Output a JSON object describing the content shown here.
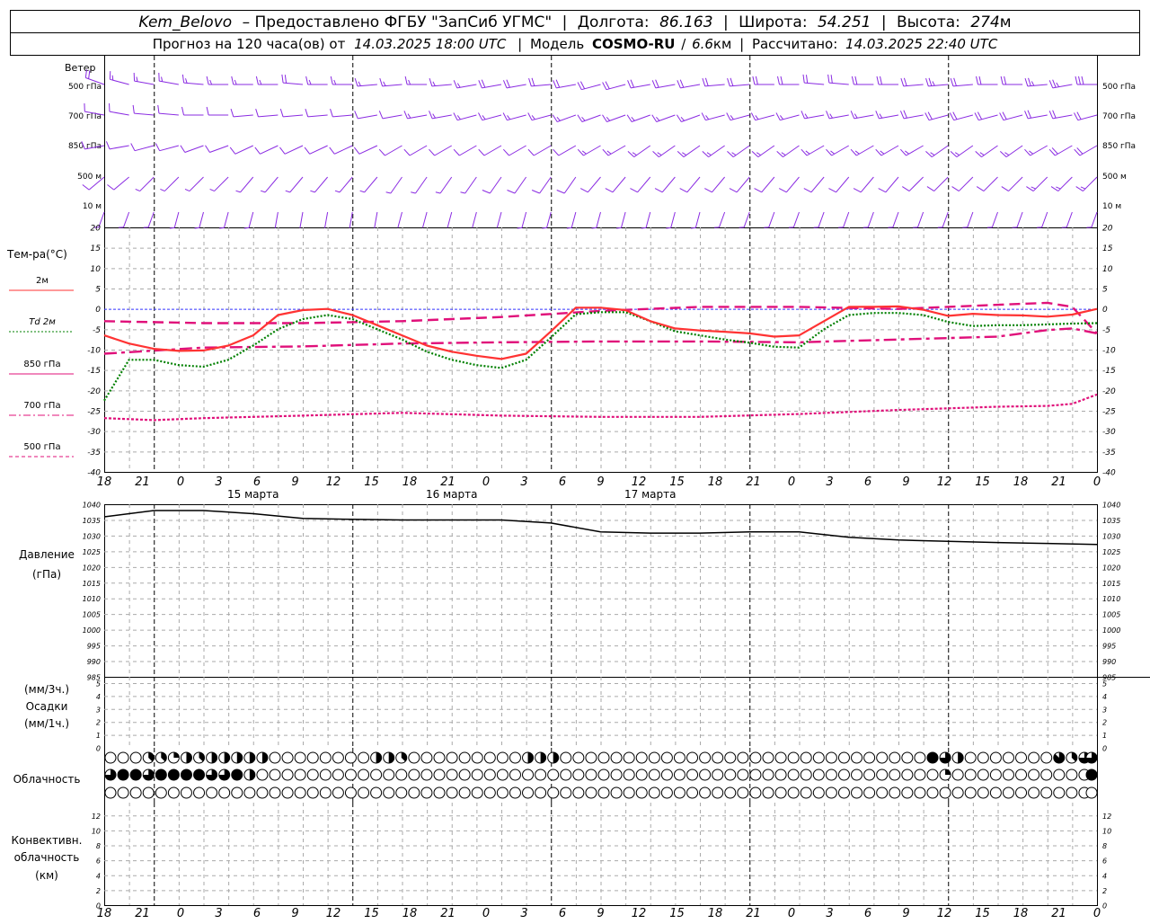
{
  "header": {
    "station": "Kem_Belovo",
    "provided": "– Предоставлено ФГБУ \"ЗапСиб УГМС\"",
    "lon_label": "Долгота:",
    "lon_value": "86.163",
    "lat_label": "Широта:",
    "lat_value": "54.251",
    "alt_label": "Высота:",
    "alt_value": "274",
    "alt_unit": "м",
    "forecast_prefix": "Прогноз на 120 часа(ов) от",
    "forecast_from": "14.03.2025 18:00 UTC",
    "model_label": "Модель",
    "model_name": "COSMO-RU",
    "model_res": "6.6",
    "model_res_unit": "км",
    "calc_label": "Рассчитано:",
    "calc_time": "14.03.2025 22:40 UTC"
  },
  "wind_panel": {
    "title": "Ветер",
    "levels": [
      "500 гПа",
      "700 гПа",
      "850 гПа",
      "500 м",
      "10 м"
    ]
  },
  "temp_panel": {
    "title": "Тем-ра(°C)",
    "legend": [
      {
        "label": "2м",
        "color": "#ff3333",
        "dash": "solid"
      },
      {
        "label": "Td  2м",
        "color": "#008000",
        "dash": "dotted"
      },
      {
        "label": "850 гПа",
        "color": "#e0107a",
        "dash": "solid"
      },
      {
        "label": "700 гПа",
        "color": "#e0107a",
        "dash": "dashdot"
      },
      {
        "label": "500 гПа",
        "color": "#e0107a",
        "dash": "dashed"
      }
    ]
  },
  "pressure_panel": {
    "title": "Давление",
    "unit": "(гПа)"
  },
  "precip_panel": {
    "unit_top": "(мм/3ч.)",
    "title": "Осадки",
    "unit_bottom": "(мм/1ч.)"
  },
  "cloud_panel": {
    "title": "Облачность"
  },
  "conv_panel": {
    "title_1": "Конвективн.",
    "title_2": "облачность",
    "unit": "(км)"
  },
  "time_axis": {
    "hour_labels": [
      "18",
      "21",
      "0",
      "3",
      "6",
      "9",
      "12",
      "15",
      "18",
      "21",
      "0",
      "3",
      "6",
      "9",
      "12",
      "15",
      "18",
      "21",
      "0",
      "3",
      "6",
      "9",
      "12",
      "15",
      "18",
      "21",
      "0"
    ],
    "date_labels": [
      "15 марта",
      "16 марта",
      "17 марта"
    ]
  },
  "colors": {
    "wind": "#8a2be2",
    "t2m": "#ff3333",
    "td": "#008000",
    "upper": "#e0107a",
    "zero_line": "#3333ff"
  },
  "chart_data": [
    {
      "type": "line",
      "title": "Тем-ра(°C)",
      "x_unit": "hours from 14.03.2025 18:00 UTC",
      "ylim": [
        -40,
        20
      ],
      "yticks": [
        20,
        15,
        10,
        5,
        0,
        -5,
        -10,
        -15,
        -20,
        -25,
        -30,
        -35,
        -40
      ],
      "grid": true,
      "series": [
        {
          "name": "2м",
          "x": [
            0,
            3,
            6,
            9,
            12,
            15,
            18,
            21,
            24,
            27,
            30,
            33,
            36,
            39,
            42,
            45,
            48,
            51,
            54,
            57,
            60,
            63,
            66,
            69,
            72,
            75,
            78,
            81,
            84,
            87,
            90,
            93,
            96,
            99,
            102,
            105,
            108,
            111,
            114,
            117,
            120
          ],
          "values": [
            -6.5,
            -8.5,
            -9.8,
            -10.3,
            -10.2,
            -9.0,
            -6.5,
            -1.5,
            -0.3,
            0.0,
            -1.5,
            -4.0,
            -6.5,
            -9.0,
            -10.5,
            -11.5,
            -12.3,
            -11.0,
            -5.5,
            0.3,
            0.3,
            -0.3,
            -3.0,
            -4.8,
            -5.3,
            -5.6,
            -6.0,
            -6.8,
            -6.5,
            -3.0,
            0.5,
            0.5,
            0.6,
            -0.2,
            -1.7,
            -1.2,
            -1.5,
            -1.6,
            -1.9,
            -1.4,
            0.0
          ]
        },
        {
          "name": "Td  2м",
          "x": [
            0,
            3,
            6,
            9,
            12,
            15,
            18,
            21,
            24,
            27,
            30,
            33,
            36,
            39,
            42,
            45,
            48,
            51,
            54,
            57,
            60,
            63,
            66,
            69,
            72,
            75,
            78,
            81,
            84,
            87,
            90,
            93,
            96,
            99,
            102,
            105,
            108,
            111,
            114,
            117,
            120
          ],
          "values": [
            -22.5,
            -12.5,
            -12.5,
            -13.8,
            -14.2,
            -12.5,
            -9.0,
            -5.0,
            -2.5,
            -1.5,
            -2.5,
            -5.0,
            -7.5,
            -10.5,
            -12.5,
            -13.8,
            -14.5,
            -12.5,
            -7.0,
            -1.3,
            -0.8,
            -0.8,
            -3.0,
            -5.5,
            -6.5,
            -7.5,
            -8.3,
            -9.3,
            -9.5,
            -5.0,
            -1.5,
            -1.0,
            -1.0,
            -1.5,
            -3.2,
            -4.2,
            -4.0,
            -4.0,
            -3.8,
            -3.6,
            -3.5
          ]
        },
        {
          "name": "850 гПа",
          "x": [
            0,
            12,
            24,
            36,
            48,
            60,
            72,
            84,
            96,
            108,
            114,
            117,
            120
          ],
          "values": [
            -3.0,
            -3.5,
            -3.5,
            -3.0,
            -2.0,
            -0.5,
            0.5,
            0.5,
            0.0,
            1.0,
            1.5,
            0.5,
            -6.0
          ]
        },
        {
          "name": "700 гПа",
          "x": [
            0,
            12,
            24,
            36,
            48,
            60,
            72,
            84,
            96,
            108,
            114,
            117,
            120
          ],
          "values": [
            -11.0,
            -9.5,
            -9.2,
            -8.5,
            -8.2,
            -8.0,
            -8.0,
            -8.2,
            -7.5,
            -6.8,
            -5.2,
            -4.8,
            -6.0
          ]
        },
        {
          "name": "500 гПа",
          "x": [
            0,
            6,
            12,
            18,
            24,
            36,
            48,
            60,
            72,
            84,
            96,
            108,
            114,
            117,
            120
          ],
          "values": [
            -26.8,
            -27.3,
            -26.8,
            -26.5,
            -26.2,
            -25.5,
            -26.2,
            -26.5,
            -26.5,
            -25.8,
            -24.8,
            -24.0,
            -23.8,
            -23.3,
            -21.0
          ]
        }
      ]
    },
    {
      "type": "line",
      "title": "Давление",
      "ylabel": "(гПа)",
      "ylim": [
        985,
        1040
      ],
      "yticks": [
        1040,
        1035,
        1030,
        1025,
        1020,
        1015,
        1010,
        1005,
        1000,
        995,
        990,
        985
      ],
      "grid": true,
      "series": [
        {
          "x": [
            0,
            6,
            12,
            18,
            24,
            30,
            36,
            42,
            48,
            54,
            60,
            66,
            72,
            78,
            84,
            90,
            96,
            102,
            108,
            114,
            120
          ],
          "values": [
            1036.0,
            1038.0,
            1038.0,
            1037.0,
            1035.5,
            1035.2,
            1035.0,
            1035.0,
            1035.0,
            1034.0,
            1031.2,
            1030.8,
            1030.8,
            1031.2,
            1031.2,
            1029.5,
            1028.6,
            1028.2,
            1027.8,
            1027.5,
            1027.2
          ]
        }
      ]
    },
    {
      "type": "bar",
      "title": "Осадки",
      "ylabel": "(мм/3ч.) (мм/1ч.)",
      "ylim": [
        0,
        5
      ],
      "yticks": [
        5,
        4,
        3,
        2,
        1,
        0
      ],
      "series": [
        {
          "values": []
        }
      ]
    },
    {
      "type": "bar",
      "title": "Конвективн. облачность",
      "ylabel": "(км)",
      "ylim": [
        0,
        13
      ],
      "yticks": [
        12,
        10,
        8,
        6,
        4,
        2,
        0
      ],
      "series": [
        {
          "values": []
        }
      ]
    }
  ],
  "clouds": {
    "note": "octas per hour (0-8); rows: upper, middle, lower",
    "upper": [
      0,
      0,
      0,
      0,
      0,
      3,
      3,
      4,
      2,
      4,
      3,
      3,
      4,
      4,
      4,
      4,
      4,
      4,
      2,
      4,
      0,
      0,
      0,
      0,
      0,
      0,
      0,
      0,
      0,
      0,
      0,
      0,
      0,
      4,
      4,
      4,
      3,
      2,
      0,
      0,
      0,
      0,
      0,
      0,
      0,
      0,
      0,
      0,
      0,
      0,
      0,
      4,
      4,
      4,
      4,
      4,
      0,
      0,
      0,
      0,
      0,
      0,
      0,
      0,
      0,
      0,
      0,
      0,
      0,
      0,
      0,
      0,
      0,
      0,
      0,
      0,
      0,
      0,
      0,
      0,
      0,
      0,
      0,
      0,
      0,
      0,
      0,
      0,
      0,
      0,
      0,
      0,
      0,
      0,
      0,
      0,
      2,
      0,
      3,
      0,
      0,
      8,
      8,
      6,
      8,
      4,
      0,
      0,
      0,
      0,
      0,
      0,
      0,
      0,
      0,
      0,
      0,
      7,
      4,
      3,
      6,
      8,
      6
    ],
    "middle": [
      6,
      8,
      8,
      8,
      6,
      6,
      8,
      8,
      8,
      8,
      8,
      8,
      8,
      6,
      8,
      6,
      8,
      4,
      4,
      0,
      0,
      0,
      0,
      0,
      0,
      0,
      0,
      0,
      0,
      0,
      0,
      0,
      0,
      0,
      0,
      0,
      0,
      0,
      0,
      0,
      0,
      0,
      0,
      0,
      0,
      0,
      0,
      0,
      0,
      0,
      0,
      0,
      0,
      0,
      0,
      0,
      0,
      0,
      0,
      0,
      0,
      0,
      0,
      0,
      0,
      0,
      0,
      0,
      0,
      0,
      0,
      0,
      0,
      0,
      0,
      0,
      0,
      0,
      0,
      0,
      0,
      0,
      0,
      0,
      0,
      0,
      0,
      0,
      0,
      0,
      0,
      0,
      0,
      0,
      0,
      0,
      0,
      0,
      0,
      0,
      0,
      0,
      0,
      0,
      0,
      0,
      0,
      0,
      2,
      0,
      0,
      0,
      0,
      0,
      0,
      0,
      0,
      0,
      0,
      0,
      0,
      0,
      0,
      0,
      0,
      0,
      0,
      8,
      8
    ],
    "lower": []
  },
  "winds": {
    "note": "direction (deg from) and speed (m/s) every 3h per level",
    "500 гПа": {
      "dir": [
        290,
        285,
        280,
        280,
        275,
        270,
        270,
        270,
        275,
        270,
        270,
        265,
        265,
        270,
        265,
        260,
        260,
        260,
        265,
        260,
        255,
        255,
        260,
        260,
        260,
        265,
        265,
        270,
        270,
        275,
        275,
        270,
        270,
        265,
        265,
        265,
        270,
        270,
        265,
        260,
        270
      ],
      "spd": [
        18,
        17,
        16,
        15,
        15,
        15,
        15,
        16,
        18,
        17,
        17,
        16,
        16,
        16,
        16,
        17,
        18,
        18,
        19,
        19,
        20,
        20,
        20,
        19,
        19,
        18,
        18,
        18,
        18,
        18,
        18,
        20,
        21,
        22,
        23,
        22,
        22,
        22,
        23,
        24,
        30
      ]
    },
    "700 гПа": {
      "dir": [
        280,
        280,
        275,
        275,
        270,
        270,
        265,
        265,
        265,
        265,
        265,
        260,
        260,
        260,
        260,
        255,
        255,
        255,
        255,
        250,
        250,
        250,
        250,
        250,
        250,
        255,
        255,
        255,
        255,
        260,
        260,
        260,
        260,
        260,
        255,
        255,
        255,
        255,
        260,
        260,
        255
      ],
      "spd": [
        12,
        12,
        11,
        11,
        11,
        11,
        11,
        11,
        12,
        12,
        12,
        12,
        12,
        13,
        13,
        13,
        14,
        14,
        14,
        15,
        15,
        15,
        15,
        16,
        16,
        16,
        16,
        16,
        16,
        16,
        16,
        17,
        17,
        18,
        18,
        18,
        19,
        19,
        20,
        20,
        22
      ]
    },
    "850 гПа": {
      "dir": [
        260,
        260,
        255,
        255,
        250,
        250,
        245,
        245,
        245,
        245,
        245,
        245,
        240,
        240,
        240,
        240,
        240,
        240,
        240,
        240,
        240,
        240,
        235,
        235,
        235,
        235,
        235,
        235,
        235,
        240,
        240,
        240,
        240,
        240,
        235,
        235,
        235,
        235,
        240,
        240,
        240
      ],
      "spd": [
        10,
        10,
        9,
        9,
        9,
        9,
        9,
        9,
        9,
        10,
        10,
        10,
        11,
        11,
        11,
        11,
        11,
        12,
        12,
        12,
        13,
        13,
        13,
        13,
        13,
        13,
        13,
        13,
        13,
        14,
        14,
        14,
        14,
        15,
        15,
        15,
        16,
        16,
        17,
        18,
        18
      ]
    },
    "500 м": {
      "dir": [
        230,
        230,
        225,
        225,
        225,
        225,
        220,
        220,
        220,
        220,
        220,
        220,
        215,
        215,
        215,
        215,
        215,
        215,
        215,
        215,
        220,
        220,
        220,
        220,
        220,
        220,
        220,
        220,
        220,
        220,
        220,
        220,
        220,
        225,
        225,
        225,
        225,
        225,
        225,
        225,
        225
      ],
      "spd": [
        8,
        8,
        7,
        7,
        7,
        6,
        6,
        6,
        6,
        6,
        6,
        6,
        7,
        7,
        7,
        7,
        8,
        8,
        8,
        8,
        9,
        9,
        9,
        9,
        9,
        9,
        9,
        9,
        10,
        10,
        10,
        10,
        11,
        11,
        12,
        12,
        12,
        12,
        13,
        13,
        13
      ]
    },
    "10 м": {
      "dir": [
        200,
        200,
        200,
        195,
        195,
        195,
        195,
        190,
        190,
        190,
        190,
        190,
        195,
        195,
        195,
        195,
        195,
        195,
        195,
        195,
        195,
        195,
        195,
        195,
        195,
        200,
        200,
        200,
        200,
        200,
        200,
        200,
        200,
        200,
        200,
        200,
        200,
        200,
        200,
        200,
        200
      ],
      "spd": [
        3,
        3,
        3,
        3,
        3,
        3,
        3,
        2,
        2,
        2,
        2,
        2,
        2,
        2,
        2,
        2,
        2,
        3,
        3,
        3,
        3,
        3,
        3,
        3,
        3,
        3,
        3,
        3,
        3,
        3,
        3,
        3,
        3,
        3,
        3,
        3,
        3,
        4,
        4,
        4,
        4
      ]
    }
  }
}
